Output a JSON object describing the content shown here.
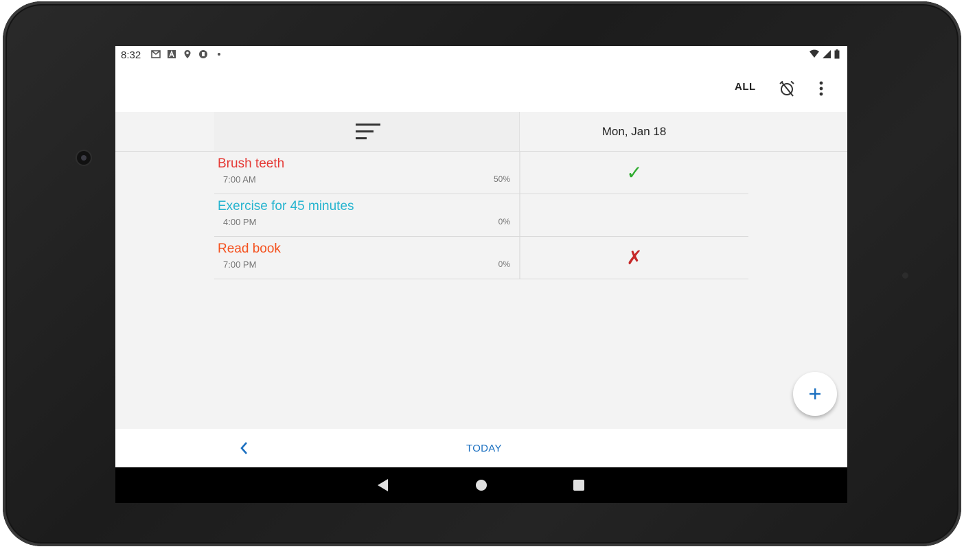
{
  "status_bar": {
    "time": "8:32",
    "left_icons": [
      "gmail-icon",
      "a-icon",
      "location-icon",
      "app-icon",
      "dot-icon"
    ],
    "right_icons": [
      "wifi-icon",
      "signal-icon",
      "battery-icon"
    ]
  },
  "app_bar": {
    "all_label": "ALL",
    "alarm_icon": "alarm-off-icon",
    "menu_icon": "more-vert-icon"
  },
  "header": {
    "sort_icon": "sort-icon",
    "date": "Mon, Jan 18"
  },
  "habits": [
    {
      "name": "Brush teeth",
      "time": "7:00 AM",
      "percent": "50%",
      "color": "#e53935",
      "mark": "✓",
      "mark_color": "#2eab2e"
    },
    {
      "name": "Exercise for 45 minutes",
      "time": "4:00 PM",
      "percent": "0%",
      "color": "#26b4cf",
      "mark": "",
      "mark_color": ""
    },
    {
      "name": "Read book",
      "time": "7:00 PM",
      "percent": "0%",
      "color": "#f4511e",
      "mark": "✗",
      "mark_color": "#c62828"
    }
  ],
  "fab": {
    "icon": "plus-icon"
  },
  "bottom_bar": {
    "back_icon": "chevron-left-icon",
    "today_label": "TODAY",
    "accent": "#1a6fc0"
  },
  "nav_bar": [
    "back-triangle-icon",
    "home-circle-icon",
    "recents-square-icon"
  ]
}
